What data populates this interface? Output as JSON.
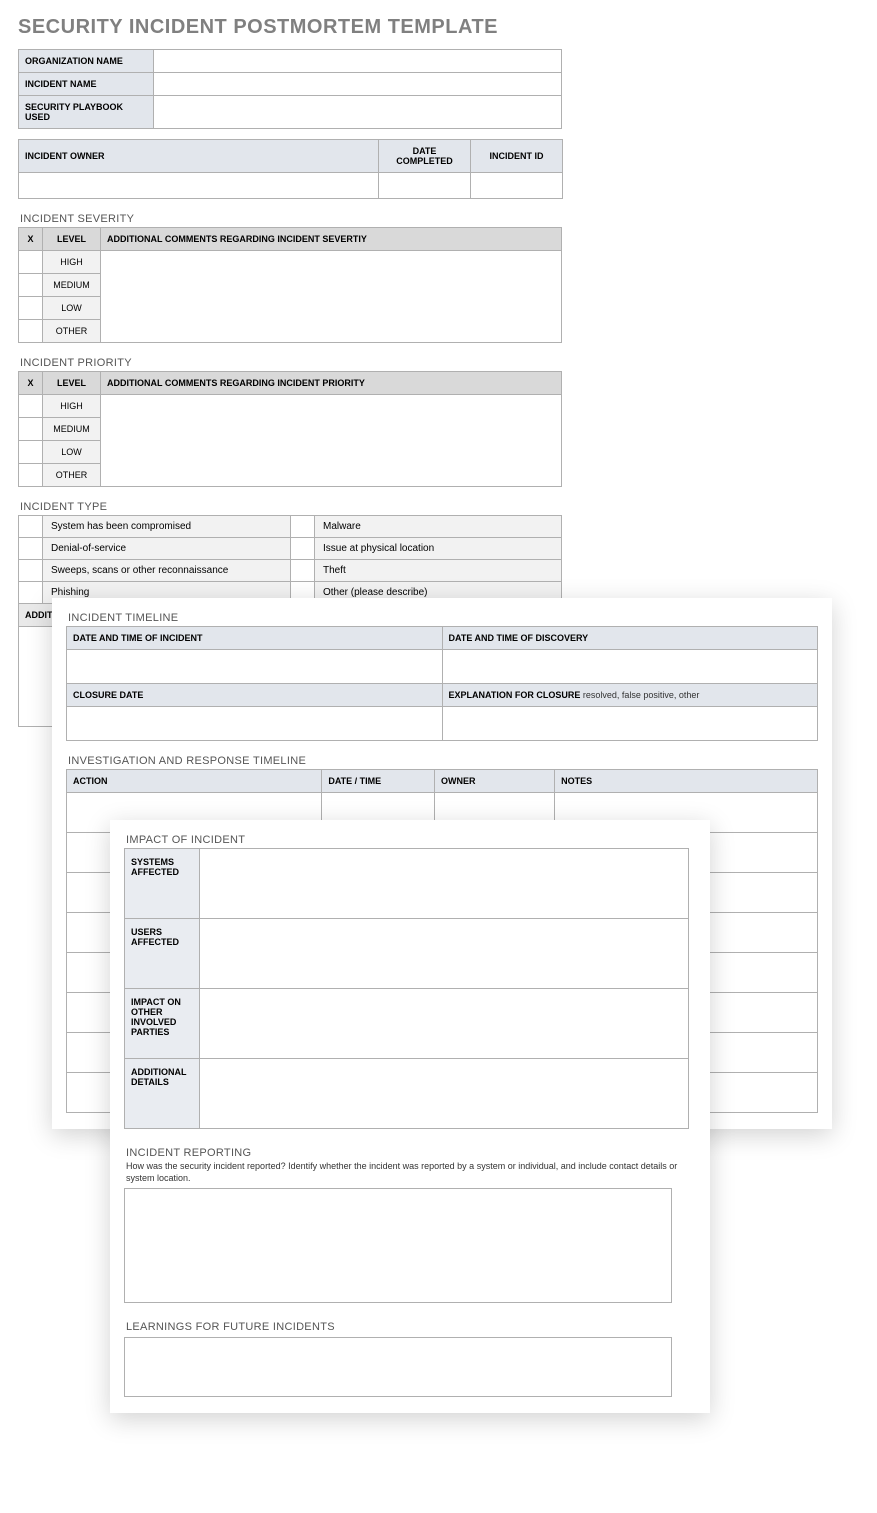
{
  "title": "SECURITY INCIDENT POSTMORTEM TEMPLATE",
  "org_table": {
    "org_label": "ORGANIZATION NAME",
    "incident_label": "INCIDENT NAME",
    "playbook_label": "SECURITY PLAYBOOK USED"
  },
  "owner_row": {
    "owner_label": "INCIDENT OWNER",
    "date_label": "DATE COMPLETED",
    "id_label": "INCIDENT ID"
  },
  "severity": {
    "heading": "INCIDENT SEVERITY",
    "x_col": "X",
    "level_col": "LEVEL",
    "comments_col": "ADDITIONAL COMMENTS REGARDING INCIDENT SEVERTIY",
    "levels": [
      "HIGH",
      "MEDIUM",
      "LOW",
      "OTHER"
    ]
  },
  "priority": {
    "heading": "INCIDENT PRIORITY",
    "x_col": "X",
    "level_col": "LEVEL",
    "comments_col": "ADDITIONAL COMMENTS REGARDING INCIDENT PRIORITY",
    "levels": [
      "HIGH",
      "MEDIUM",
      "LOW",
      "OTHER"
    ]
  },
  "incident_type": {
    "heading": "INCIDENT TYPE",
    "left": [
      "System has been compromised",
      "Denial-of-service",
      "Sweeps, scans or other reconnaissance",
      "Phishing"
    ],
    "right": [
      "Malware",
      "Issue at physical location",
      "Theft",
      "Other (please describe)"
    ],
    "additional_label": "ADDITIONAL COMMENTS / \"OTHER\" DESCRIPTION"
  },
  "timeline": {
    "heading": "INCIDENT TIMELINE",
    "dt_incident": "DATE AND TIME OF INCIDENT",
    "dt_discovery": "DATE AND TIME OF DISCOVERY",
    "closure": "CLOSURE DATE",
    "explanation_label": "EXPLANATION FOR CLOSURE",
    "explanation_note": "resolved, false positive, other"
  },
  "response": {
    "heading": "INVESTIGATION AND RESPONSE TIMELINE",
    "action": "ACTION",
    "datetime": "DATE / TIME",
    "owner": "OWNER",
    "notes": "NOTES"
  },
  "impact": {
    "heading": "IMPACT OF INCIDENT",
    "systems": "SYSTEMS AFFECTED",
    "users": "USERS AFFECTED",
    "parties": "IMPACT ON OTHER INVOLVED PARTIES",
    "details": "ADDITIONAL DETAILS"
  },
  "reporting": {
    "heading": "INCIDENT REPORTING",
    "desc": "How was the security incident reported? Identify whether the incident was reported by a system or individual, and include contact details or system location."
  },
  "learnings": {
    "heading": "LEARNINGS FOR FUTURE INCIDENTS"
  }
}
